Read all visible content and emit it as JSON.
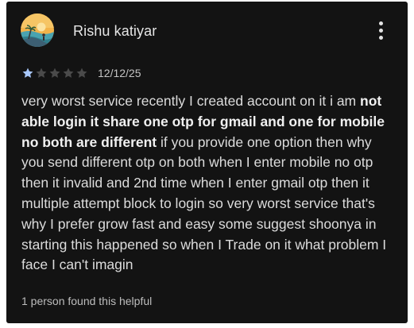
{
  "review": {
    "author": "Rishu katiyar",
    "rating": 1,
    "max_rating": 5,
    "date": "12/12/25",
    "text_part1": "very worst service recently I created account on it i am ",
    "text_bold": "not able login it share one otp for gmail and one for mobile no both are different",
    "text_part2": " if you provide one option then why you send different otp on both when I enter mobile no otp then it invalid and 2nd time when I enter gmail otp then it multiple attempt block to login so very worst service that's why I prefer grow fast and easy some suggest shoonya in starting this happened so when I Trade on it what problem I face I can't imagin",
    "helpful_text": "1 person found this helpful"
  },
  "icons": {
    "avatar": "avatar-beach-sunset-icon",
    "more": "more-vert-icon",
    "star": "star-icon"
  },
  "colors": {
    "card_background": "#131313",
    "star_filled": "#a8c7fa",
    "star_empty": "#4a4a4a",
    "text_primary": "#dcdcdc",
    "text_secondary": "#bdbdbd"
  }
}
